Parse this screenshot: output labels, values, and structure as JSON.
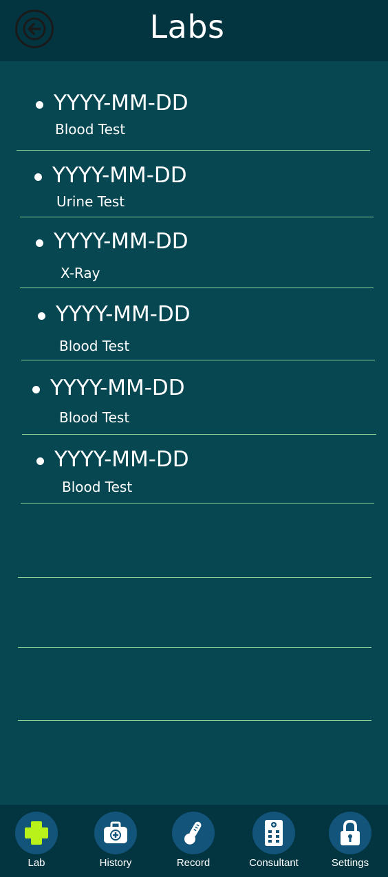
{
  "header": {
    "title": "Labs"
  },
  "labs": [
    {
      "date": "YYYY-MM-DD",
      "test": "Blood Test"
    },
    {
      "date": "YYYY-MM-DD",
      "test": "Urine Test"
    },
    {
      "date": "YYYY-MM-DD",
      "test": "X-Ray"
    },
    {
      "date": "YYYY-MM-DD",
      "test": "Blood Test"
    },
    {
      "date": "YYYY-MM-DD",
      "test": "Blood Test"
    },
    {
      "date": "YYYY-MM-DD",
      "test": "Blood Test"
    }
  ],
  "tabs": [
    {
      "label": "Lab",
      "icon": "plus-cross-icon",
      "active": true
    },
    {
      "label": "History",
      "icon": "medical-bag-icon"
    },
    {
      "label": "Record",
      "icon": "thermometer-icon"
    },
    {
      "label": "Consultant",
      "icon": "hospital-building-icon"
    },
    {
      "label": "Settings",
      "icon": "lock-icon"
    }
  ],
  "colors": {
    "background": "#064752",
    "header": "#033541",
    "divider": "#8fd39a",
    "tab_circle": "#13547a",
    "active_icon": "#b8f21a"
  }
}
